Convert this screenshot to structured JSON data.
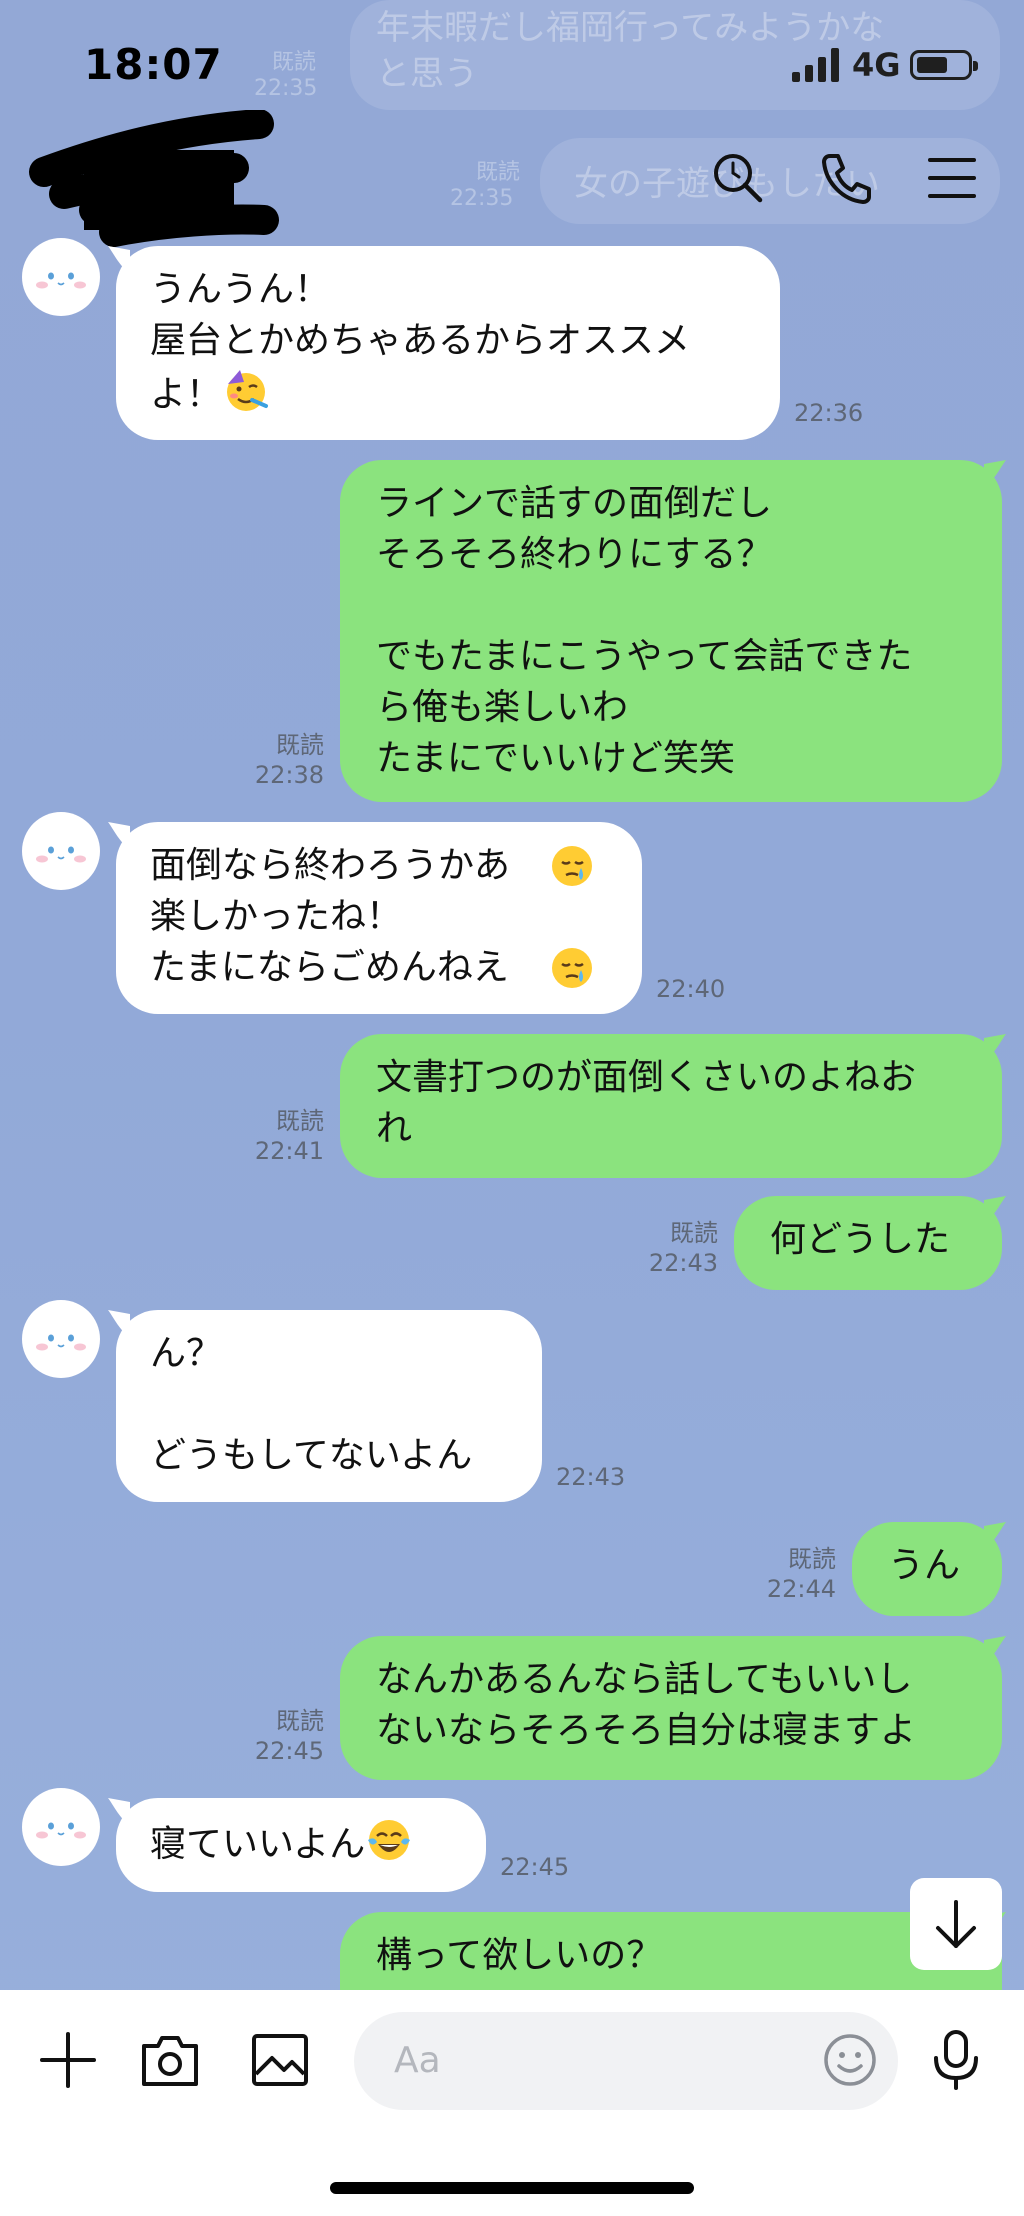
{
  "status_bar": {
    "time": "18:07",
    "network": "4G"
  },
  "background_messages": [
    {
      "text": "年末暇だし福岡行ってみようかな",
      "read_label": "既読",
      "time": "22:35"
    },
    {
      "text": "と思う"
    },
    {
      "text": "女の子遊びもしたい",
      "read_label": "既読",
      "time": "22:35"
    }
  ],
  "header": {
    "contact_name_redacted": true,
    "icons": [
      "back-icon",
      "search-icon",
      "phone-icon",
      "menu-icon"
    ]
  },
  "messages": [
    {
      "side": "in",
      "text": "うんうん！\n屋台とかめちゃあるからオススメ\nよ！",
      "emoji": "partying-face-emoji",
      "time": "22:36"
    },
    {
      "side": "out",
      "text": "ラインで話すの面倒だし\nそろそろ終わりにする？\n\nでもたまにこうやって会話できた\nら俺も楽しいわ\nたまにでいいけど笑笑",
      "read": "既読",
      "time": "22:38"
    },
    {
      "side": "in",
      "text": "面倒なら終わろうかあ\n楽しかったね！\nたまにならごめんねえ",
      "emoji": "sad-tear-face-emoji",
      "time": "22:40"
    },
    {
      "side": "out",
      "text": "文書打つのが面倒くさいのよねお\nれ",
      "read": "既読",
      "time": "22:41"
    },
    {
      "side": "out",
      "text": "何どうした",
      "read": "既読",
      "time": "22:43"
    },
    {
      "side": "in",
      "text": "ん？\n\nどうもしてないよん",
      "time": "22:43"
    },
    {
      "side": "out",
      "text": "うん",
      "read": "既読",
      "time": "22:44"
    },
    {
      "side": "out",
      "text": "なんかあるんなら話してもいいし\nないならそろそろ自分は寝ますよ",
      "read": "既読",
      "time": "22:45"
    },
    {
      "side": "in",
      "text": "寝ていいよん",
      "emoji": "tears-of-joy-emoji",
      "time": "22:45"
    },
    {
      "side": "out",
      "text": "構って欲しいの？"
    }
  ],
  "input_bar": {
    "placeholder": "Aa",
    "icons": [
      "plus-icon",
      "camera-icon",
      "image-icon",
      "emoji-icon",
      "microphone-icon"
    ]
  },
  "colors": {
    "background": "#93a8d6",
    "outgoing_bubble": "#8be37e",
    "incoming_bubble": "#ffffff"
  }
}
